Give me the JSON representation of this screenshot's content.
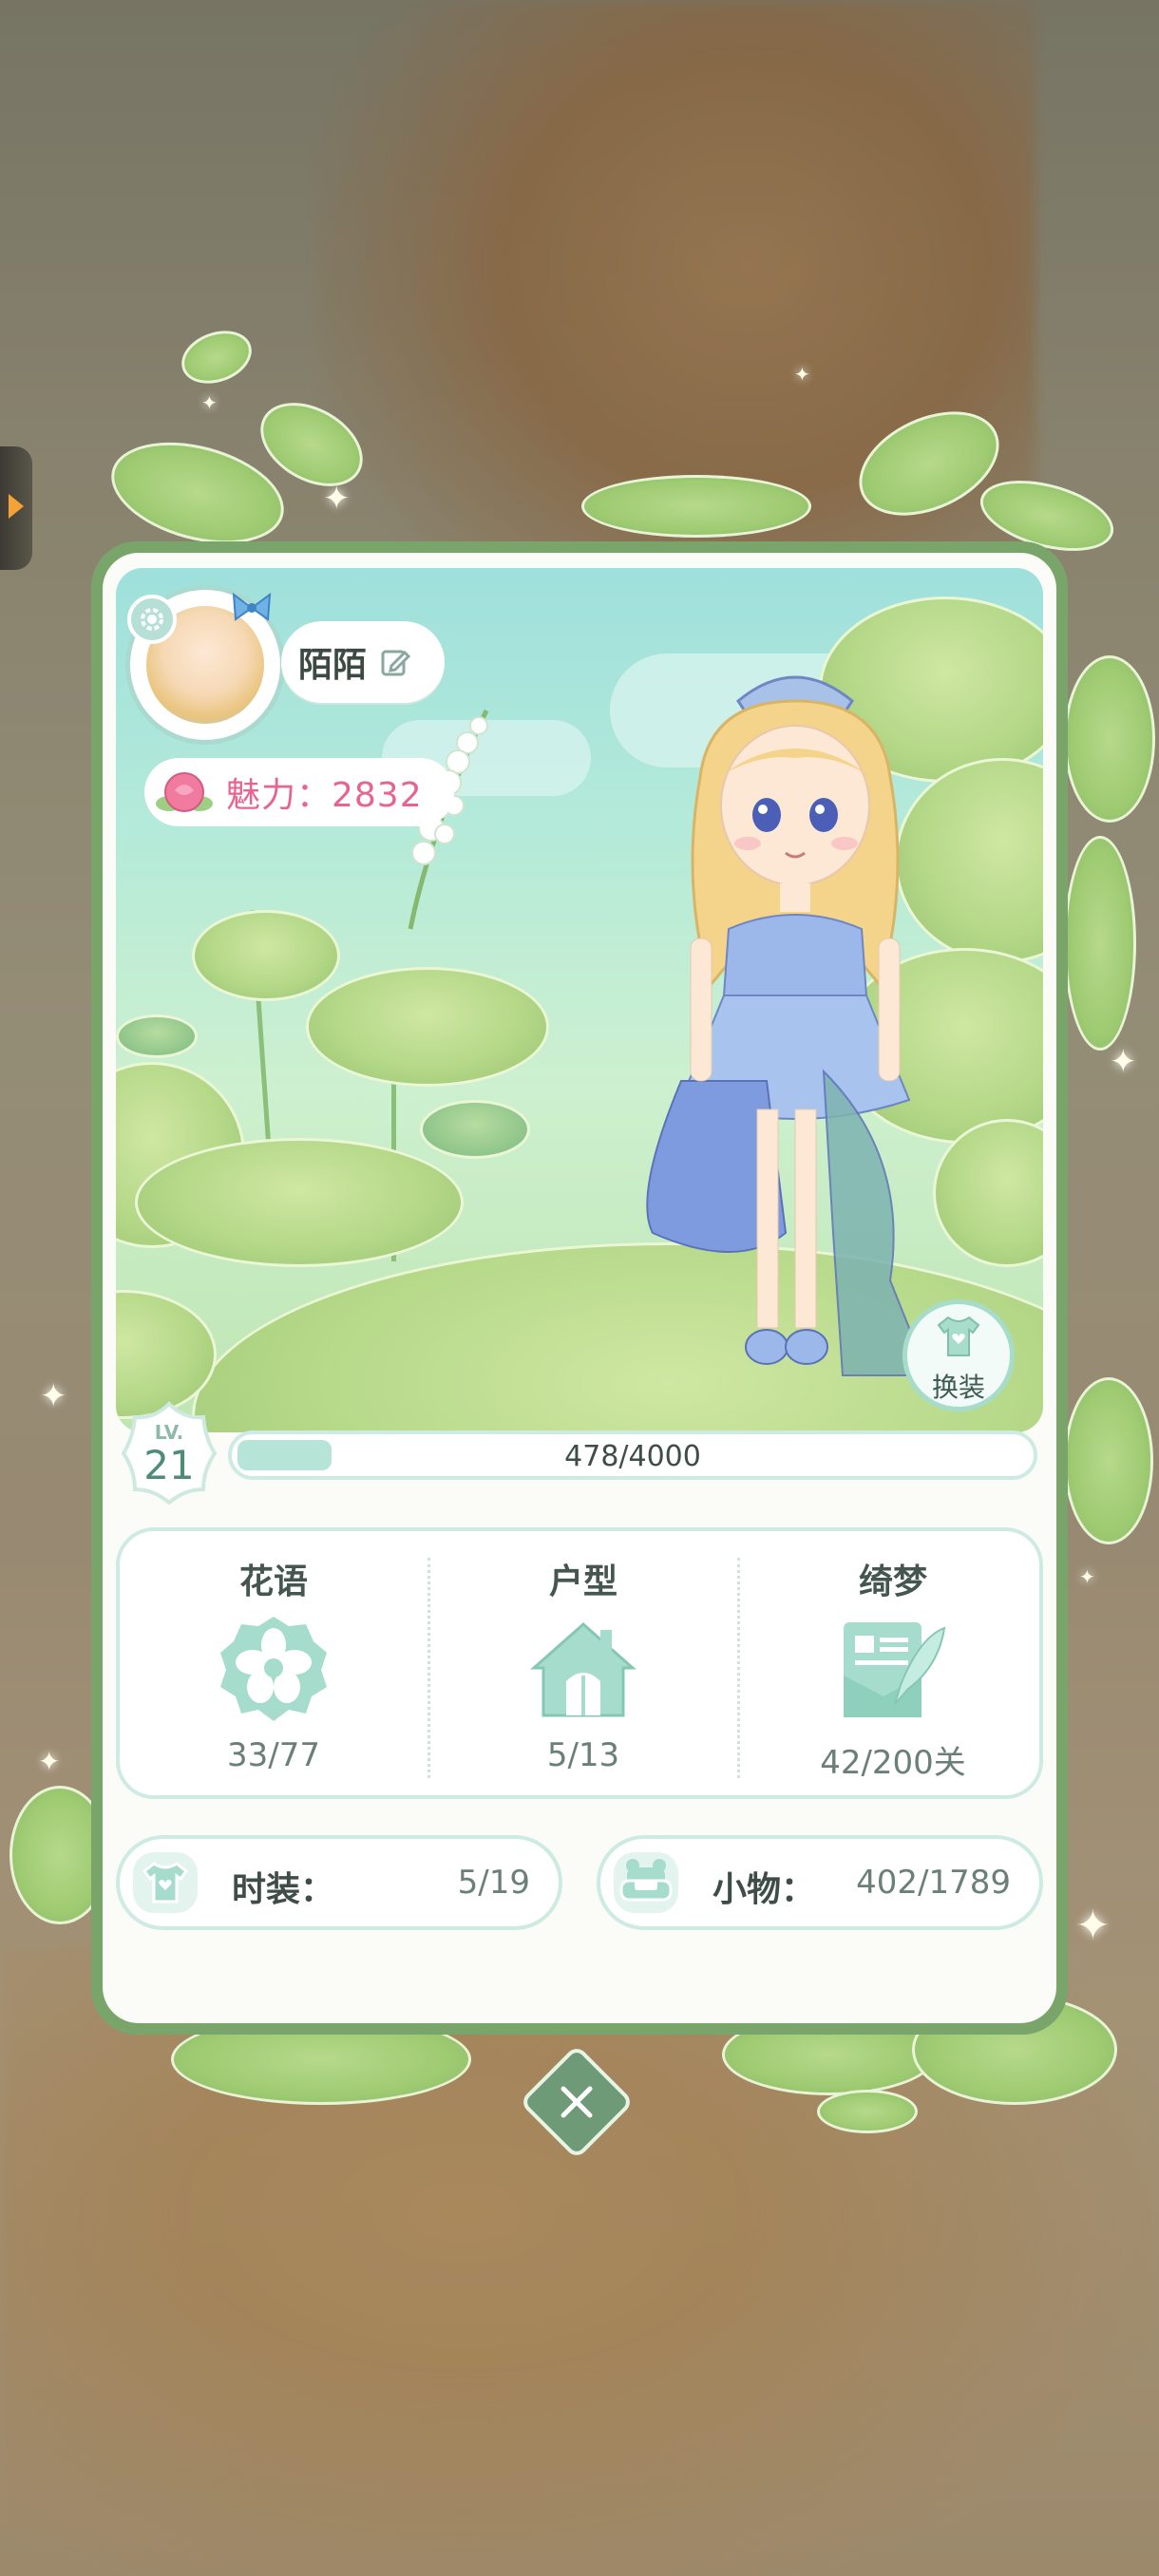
{
  "profile": {
    "name": "陌陌",
    "charm_label": "魅力：2832"
  },
  "scene": {
    "costume_button_label": "换装"
  },
  "level": {
    "lv_label": "LV.",
    "value": "21",
    "xp_text": "478/4000",
    "xp_fraction": 0.1195
  },
  "stats": [
    {
      "title": "花语",
      "value": "33/77",
      "icon": "flower-icon"
    },
    {
      "title": "户型",
      "value": "5/13",
      "icon": "house-icon"
    },
    {
      "title": "绮梦",
      "value": "42/200关",
      "icon": "letter-quill-icon"
    }
  ],
  "collections": [
    {
      "label": "时装：",
      "value": "5/19",
      "icon": "shirt-icon"
    },
    {
      "label": "小物：",
      "value": "402/1789",
      "icon": "sofa-icon"
    }
  ],
  "colors": {
    "card_border": "#7aa56a",
    "accent_teal": "#4f8a7a",
    "charm_pink": "#e7648f"
  }
}
